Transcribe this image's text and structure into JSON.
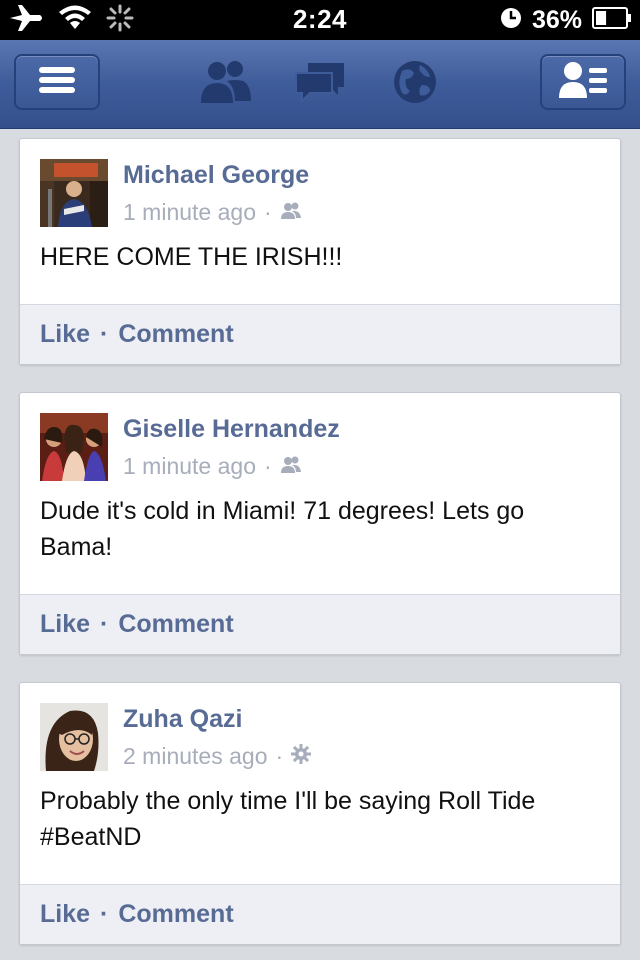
{
  "status_bar": {
    "time": "2:24",
    "battery_percent": "36%",
    "battery_level": 0.36,
    "icons": [
      "airplane-icon",
      "wifi-icon",
      "activity-spinner-icon",
      "clock-icon",
      "battery-icon"
    ]
  },
  "nav_bar": {
    "icons": [
      "menu-icon",
      "friend-requests-icon",
      "messages-icon",
      "notifications-globe-icon",
      "profile-icon"
    ],
    "accent": "#3b5998"
  },
  "posts": [
    {
      "author": "Michael George",
      "time": "1 minute ago",
      "privacy_icon": "friends-icon",
      "text": "HERE COME THE IRISH!!!",
      "like_label": "Like",
      "comment_label": "Comment"
    },
    {
      "author": "Giselle Hernandez",
      "time": "1 minute ago",
      "privacy_icon": "friends-icon",
      "text": "Dude it's cold in Miami! 71 degrees! Lets go Bama!",
      "like_label": "Like",
      "comment_label": "Comment"
    },
    {
      "author": "Zuha Qazi",
      "time": "2 minutes ago",
      "privacy_icon": "gear-icon",
      "text": "Probably the only time I'll be saying Roll Tide #BeatND",
      "like_label": "Like",
      "comment_label": "Comment"
    }
  ]
}
